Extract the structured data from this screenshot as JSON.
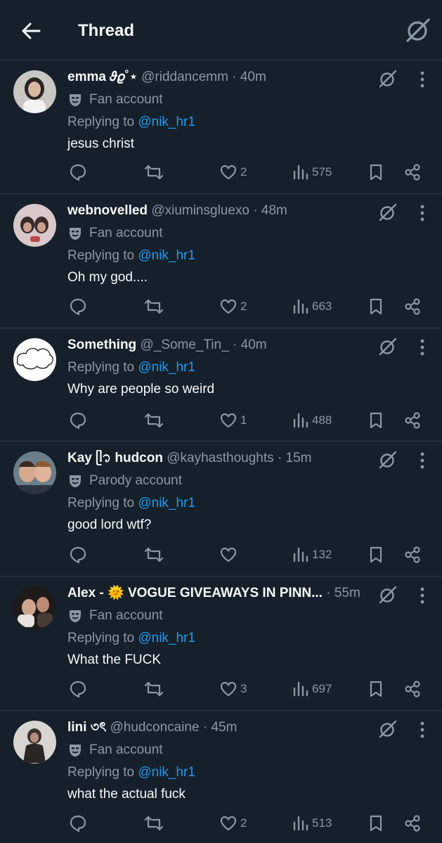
{
  "header": {
    "title": "Thread",
    "back_icon": "arrow-left-icon",
    "grok_icon": "grok-icon"
  },
  "colors": {
    "background": "#15202b",
    "divider": "#2f3b47",
    "muted": "#8b98a5",
    "link": "#1d9bf0",
    "text": "#f7f9f9"
  },
  "replies": [
    {
      "name": "emma 𝜗𝜚˚⋆",
      "handle": "@riddancemm",
      "time": "40m",
      "label": "Fan account",
      "replying_prefix": "Replying to ",
      "mention": "@nik_hr1",
      "text": "jesus christ",
      "likes": "2",
      "views": "575"
    },
    {
      "name": "webnovelled",
      "handle": "@xiuminsgluexo",
      "time": "48m",
      "label": "Fan account",
      "replying_prefix": "Replying to ",
      "mention": "@nik_hr1",
      "text": "Oh my god....",
      "likes": "2",
      "views": "663"
    },
    {
      "name": "Something",
      "handle": "@_Some_Tin_",
      "time": "40m",
      "label": "",
      "replying_prefix": "Replying to ",
      "mention": "@nik_hr1",
      "text": "Why are people so weird",
      "likes": "1",
      "views": "488"
    },
    {
      "name": "Kay ᥫ᭡ hudcon",
      "handle": "@kayhasthoughts",
      "time": "15m",
      "label": "Parody account",
      "replying_prefix": "Replying to ",
      "mention": "@nik_hr1",
      "text": "good lord wtf?",
      "likes": "",
      "views": "132"
    },
    {
      "name": "Alex - 🌞 VOGUE GIVEAWAYS IN PINN...",
      "handle": "",
      "time": "55m",
      "label": "Fan account",
      "replying_prefix": "Replying to ",
      "mention": "@nik_hr1",
      "text": "What the FUCK",
      "likes": "3",
      "views": "697"
    },
    {
      "name": "lini ৩ৎ",
      "handle": "@hudconcaine",
      "time": "45m",
      "label": "Fan account",
      "replying_prefix": "Replying to ",
      "mention": "@nik_hr1",
      "text": "what the actual fuck",
      "likes": "2",
      "views": "513"
    }
  ]
}
